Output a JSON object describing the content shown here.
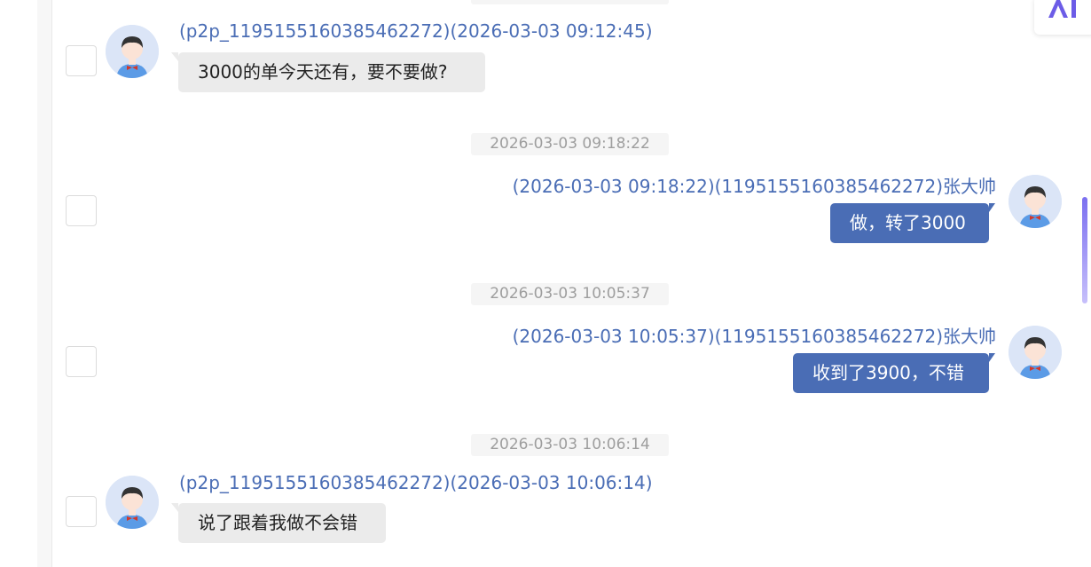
{
  "ai_badge": {
    "label": "AI",
    "color": "#6c5ce7"
  },
  "colors": {
    "meta_text": "#4a6db5",
    "outgoing_bubble": "#4a6db5",
    "incoming_bubble": "#ebebeb",
    "time_divider_text": "#9e9e9e"
  },
  "messages": [
    {
      "direction": "incoming",
      "meta": "(p2p_1195155160385462272)(2026-03-03 09:12:45)",
      "text": "3000的单今天还有，要不要做?"
    },
    {
      "divider": "2026-03-03 09:18:22",
      "direction": "outgoing",
      "meta": "(2026-03-03 09:18:22)(1195155160385462272)张大帅",
      "text": "做，转了3000"
    },
    {
      "divider": "2026-03-03 10:05:37",
      "direction": "outgoing",
      "meta": "(2026-03-03 10:05:37)(1195155160385462272)张大帅",
      "text": "收到了3900，不错"
    },
    {
      "divider": "2026-03-03 10:06:14",
      "direction": "incoming",
      "meta": "(p2p_1195155160385462272)(2026-03-03 10:06:14)",
      "text": "说了跟着我做不会错"
    }
  ]
}
